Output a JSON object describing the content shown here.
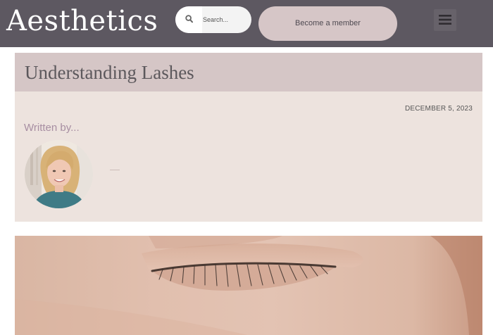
{
  "header": {
    "logo_text": "Aesthetics",
    "search": {
      "placeholder": "Search...",
      "icon": "search-icon"
    },
    "member_button_label": "Become a member",
    "menu_icon": "hamburger-menu-icon"
  },
  "post": {
    "title": "Understanding Lashes",
    "date": "DECEMBER 5, 2023",
    "written_by_label": "Written by...",
    "author_name": "",
    "hero_image": "closed-eye-lashes-photo"
  },
  "colors": {
    "header_bg": "#5d5861",
    "member_button_bg": "#d6c6c7",
    "title_band_bg": "#d5c6c6",
    "card_bg": "#ede3de",
    "written_by_color": "#a78ea2"
  }
}
